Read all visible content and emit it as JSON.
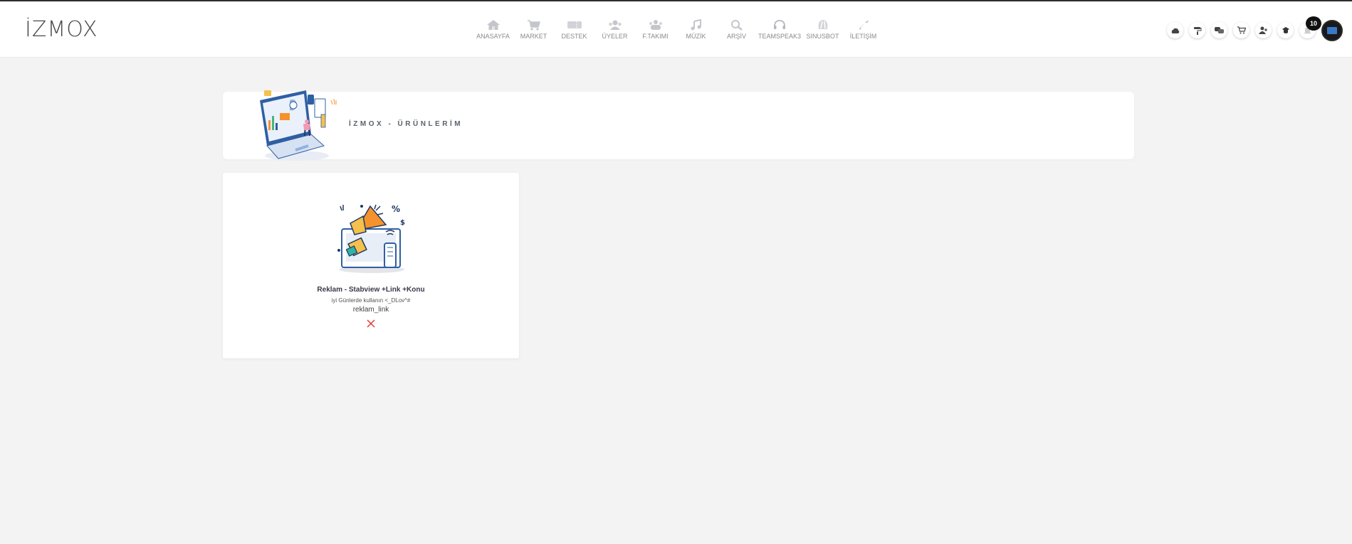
{
  "brand": {
    "logo_text": "İZMOX"
  },
  "nav": {
    "items": [
      {
        "label": "ANASAYFA",
        "icon": "home-icon"
      },
      {
        "label": "MARKET",
        "icon": "cart-icon"
      },
      {
        "label": "DESTEK",
        "icon": "ticket-icon"
      },
      {
        "label": "ÜYELER",
        "icon": "users-icon"
      },
      {
        "label": "F.TAKIMI",
        "icon": "team-icon"
      },
      {
        "label": "MÜZİK",
        "icon": "music-icon"
      },
      {
        "label": "ARŞİV",
        "icon": "search-icon"
      },
      {
        "label": "TEAMSPEAK3",
        "icon": "headset-icon"
      },
      {
        "label": "SINUSBOT",
        "icon": "bot-icon"
      },
      {
        "label": "İLETİŞİM",
        "icon": "phone-icon"
      }
    ]
  },
  "user_bar": {
    "icons": [
      "cloud-icon",
      "paint-roller-icon",
      "chat-icon",
      "cart-icon",
      "user-add-icon",
      "graduation-cap-icon",
      "bell-icon"
    ],
    "notification_count": "10",
    "avatar": "avatar"
  },
  "page": {
    "title": "İZMOX - ÜRÜNLERİM"
  },
  "products": [
    {
      "name": "Reklam - Stabview +Link +Konu",
      "description": "iyi Günlerde kullanın <_DLov^#",
      "code": "reklam_link",
      "status_icon": "close-icon",
      "status_color": "#e53935"
    }
  ],
  "colors": {
    "accent_orange": "#f6922d",
    "accent_blue": "#2f5fa3",
    "status_red": "#e53935"
  }
}
